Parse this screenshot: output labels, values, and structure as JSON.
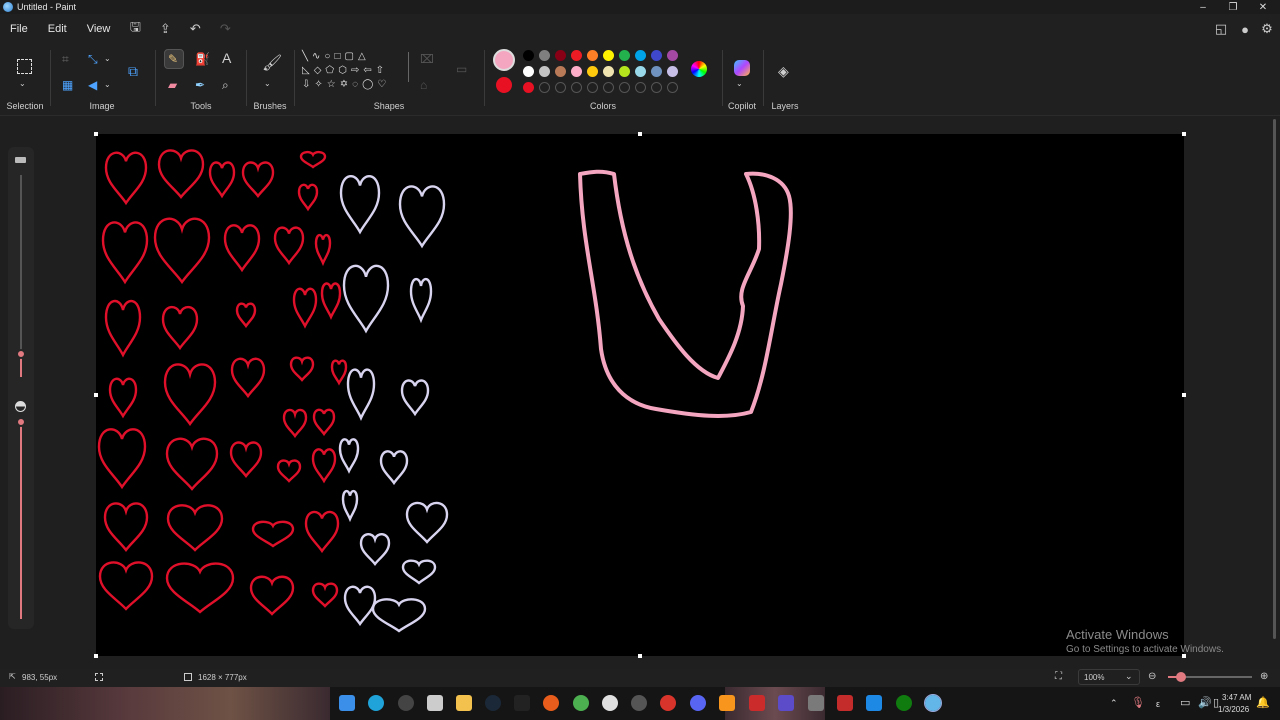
{
  "app": {
    "title": "Untitled - Paint"
  },
  "menu": {
    "file": "File",
    "edit": "Edit",
    "view": "View"
  },
  "ribbon": {
    "groups": {
      "selection": "Selection",
      "image": "Image",
      "tools": "Tools",
      "brushes": "Brushes",
      "shapes": "Shapes",
      "colors": "Colors",
      "copilot": "Copilot",
      "layers": "Layers"
    },
    "tool_text_glyph": "A",
    "primary_color": "#f4a6c0",
    "secondary_color": "#e81123",
    "palette_row1": [
      "#000000",
      "#7f7f7f",
      "#880015",
      "#ed1c24",
      "#ff7f27",
      "#fff200",
      "#22b14c",
      "#00a2e8",
      "#3f48cc",
      "#a349a4"
    ],
    "palette_row2": [
      "#ffffff",
      "#c3c3c3",
      "#b97a57",
      "#ffaec9",
      "#ffc90e",
      "#efe4b0",
      "#b5e61d",
      "#99d9ea",
      "#7092be",
      "#c8bfe7"
    ],
    "custom_row": [
      "#e81123",
      "",
      "",
      "",
      "",
      "",
      "",
      "",
      "",
      ""
    ]
  },
  "canvas": {
    "background": "#000000",
    "heart_colors": {
      "red": "#e0102a",
      "lavender": "#d8d4f0"
    },
    "stroke_color": "#f4a6c0"
  },
  "watermark": {
    "line1": "Activate Windows",
    "line2": "Go to Settings to activate Windows."
  },
  "status": {
    "cursor_pos": "983, 55px",
    "canvas_size": "1628 × 777px",
    "zoom": "100%"
  },
  "taskbar": {
    "time": "3:47 AM",
    "date": "1/3/2026",
    "lang": "ε"
  }
}
